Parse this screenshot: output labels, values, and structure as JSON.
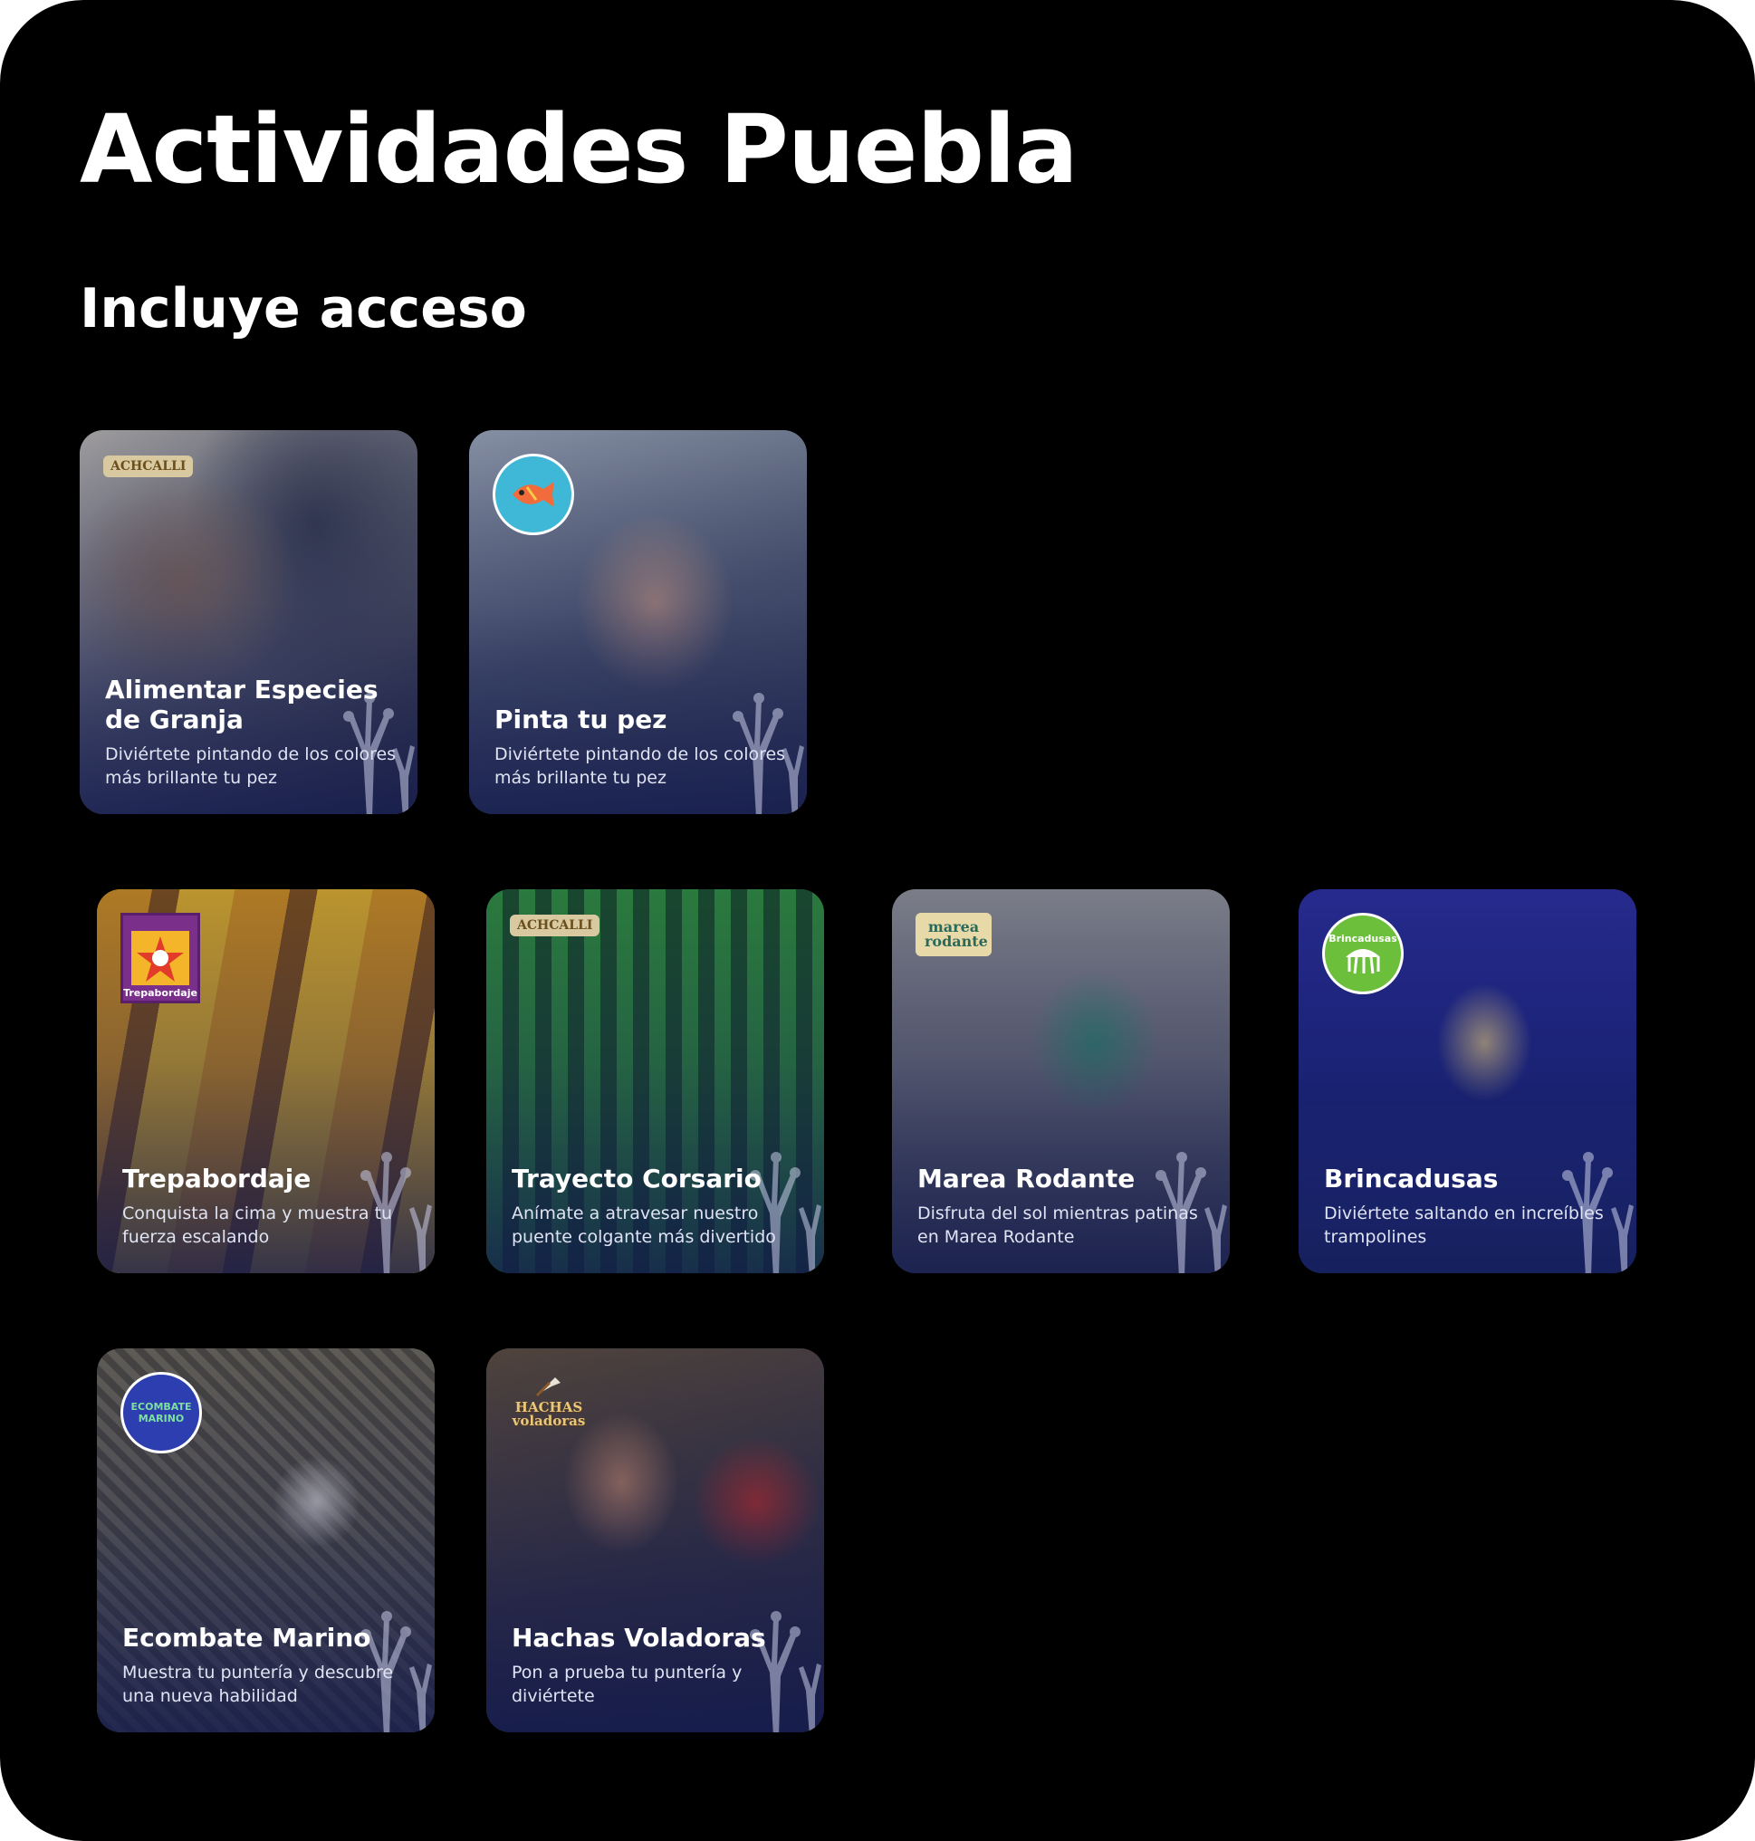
{
  "page": {
    "title": "Actividades Puebla",
    "subtitle": "Incluye acceso"
  },
  "cards": [
    {
      "title": "Alimentar Especies de Granja",
      "description": "Diviértete pintando de los colores más brillante tu pez",
      "logo_icon": "achcalli-logo",
      "logo_text": "ACHCALLI"
    },
    {
      "title": "Pinta tu pez",
      "description": "Diviértete pintando de los colores más brillante tu pez",
      "logo_icon": "fish-logo"
    },
    {
      "title": "Trepabordaje",
      "description": "Conquista la cima y muestra tu fuerza escalando",
      "logo_icon": "trepabordaje-logo",
      "logo_text": "Trepabordaje"
    },
    {
      "title": "Trayecto Corsario",
      "description": "Anímate a atravesar nuestro puente colgante más divertido",
      "logo_icon": "achcalli-logo",
      "logo_text": "ACHCALLI"
    },
    {
      "title": "Marea Rodante",
      "description": "Disfruta del sol mientras patinas en Marea Rodante",
      "logo_icon": "marea-rodante-logo",
      "logo_text": "marea rodante"
    },
    {
      "title": "Brincadusas",
      "description": "Diviértete saltando en increíbles trampolines",
      "logo_icon": "brincadusas-logo",
      "logo_text": "Brincadusas"
    },
    {
      "title": "Ecombate Marino",
      "description": "Muestra tu puntería y descubre una nueva habilidad",
      "logo_icon": "ecombate-marino-logo",
      "logo_text": "ECOMBATE MARINO"
    },
    {
      "title": "Hachas Voladoras",
      "description": "Pon a prueba tu puntería y diviértete",
      "logo_icon": "hachas-voladoras-logo",
      "logo_text": "HACHAS voladoras"
    }
  ],
  "colors": {
    "background": "#000000",
    "text": "#ffffff",
    "card_overlay": "#141c50"
  }
}
